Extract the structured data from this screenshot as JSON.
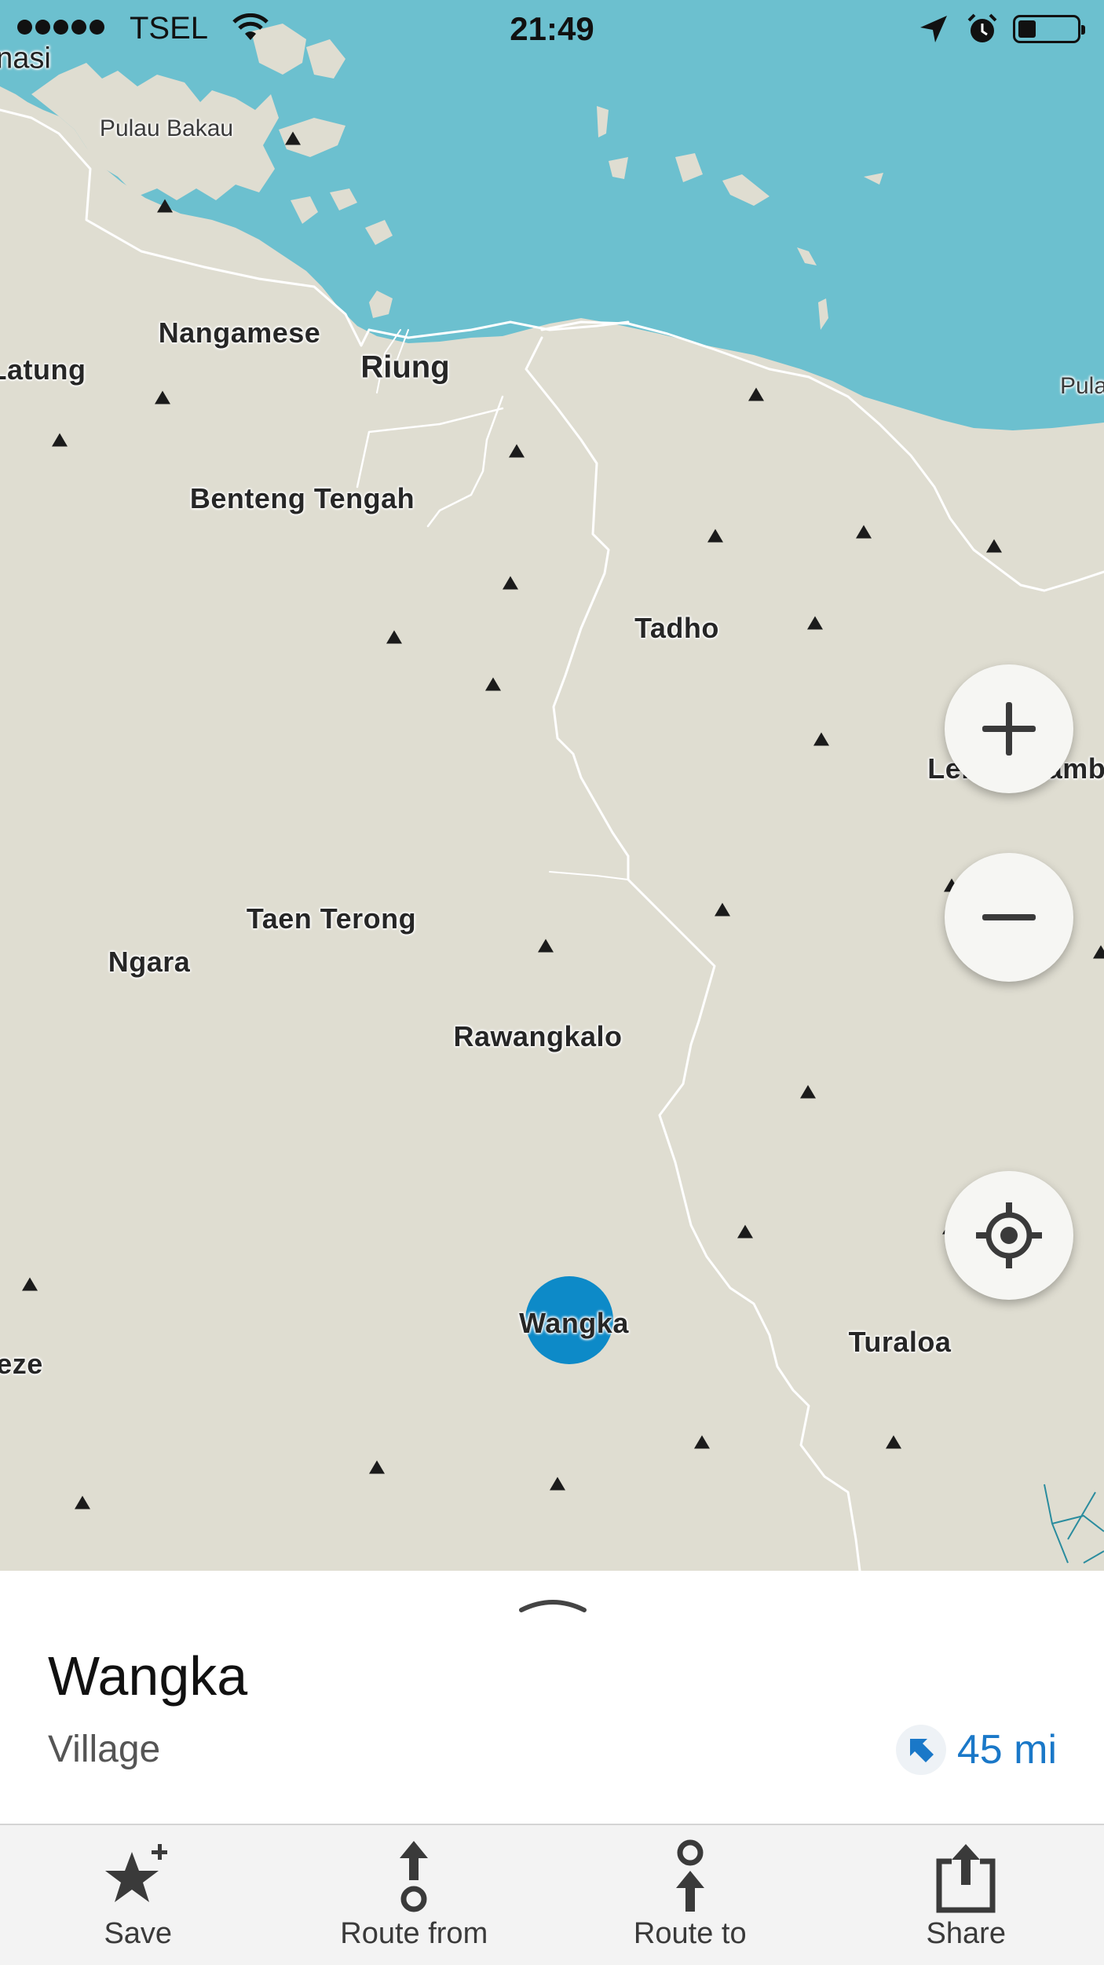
{
  "status_bar": {
    "carrier": "TSEL",
    "time": "21:49",
    "battery_level": 0.3
  },
  "map": {
    "place_labels": {
      "pulau_bakau": "Pulau Bakau",
      "nangamese": "Nangamese",
      "latung": "Latung",
      "riung": "Riung",
      "benteng_tengah": "Benteng Tengah",
      "tadho": "Tadho",
      "lengkosambi": "Lengkosambi",
      "taen_terong": "Taen Terong",
      "ngara": "Ngara",
      "rawangkalo": "Rawangkalo",
      "wangka": "Wangka",
      "turaloa": "Turaloa",
      "edge_top_left": "nasi",
      "edge_right": "Pula",
      "edge_bottom_left": "eze"
    },
    "colors": {
      "water": "#6cc0cf",
      "land": "#dfddd1",
      "road": "#ffffff",
      "selected_marker": "#0d8ac8"
    },
    "controls": {
      "zoom_in": "plus-icon",
      "zoom_out": "minus-icon",
      "locate": "crosshair-icon"
    }
  },
  "place_card": {
    "name": "Wangka",
    "category": "Village",
    "distance": "45 mi",
    "distance_icon": "direction-arrow-icon",
    "accent": "#1a78c8"
  },
  "toolbar": {
    "save": "Save",
    "route_from": "Route from",
    "route_to": "Route to",
    "share": "Share"
  }
}
